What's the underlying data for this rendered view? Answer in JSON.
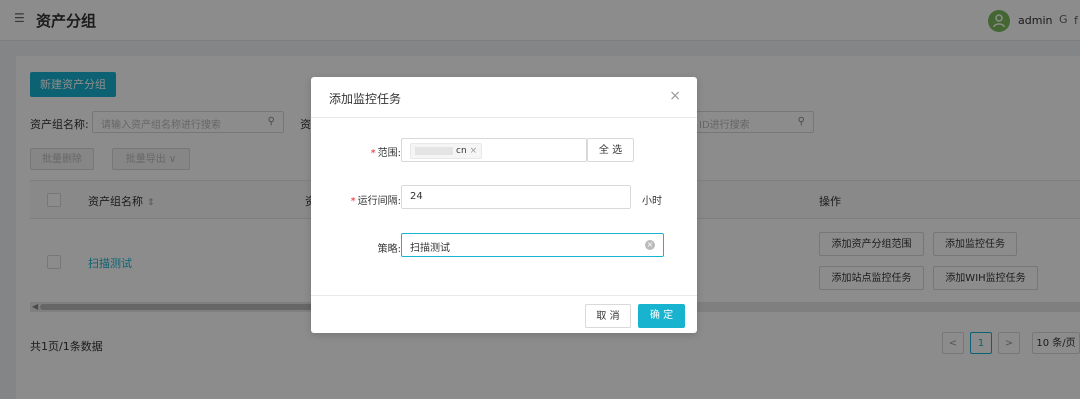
{
  "header": {
    "menu_icon": "menu-fold-icon",
    "title": "资产分组",
    "user": "admin",
    "logout_glyph": "G",
    "extra_glyph": "f"
  },
  "toolbar": {
    "new_group_label": "新建资产分组"
  },
  "filters": {
    "group_name_label": "资产组名称:",
    "group_name_placeholder": "请输入资产组名称进行搜索",
    "second_label_partial": "资",
    "third_placeholder_partial": "ID进行搜索"
  },
  "bulk": {
    "delete_label": "批量删除",
    "export_label": "批量导出",
    "export_caret": "∨"
  },
  "table": {
    "columns": [
      "资产组名称",
      "资",
      "操作"
    ],
    "sort_glyph": "⇕",
    "rows": [
      {
        "name": "扫描测试",
        "actions": [
          "添加资产分组范围",
          "添加监控任务",
          "添加站点监控任务",
          "添加WIH监控任务"
        ]
      }
    ]
  },
  "pagination": {
    "summary": "共1页/1条数据",
    "prev": "<",
    "current": "1",
    "next": ">",
    "page_size": "10 条/页"
  },
  "modal": {
    "title": "添加监控任务",
    "close_glyph": "×",
    "fields": {
      "scope_label": "范围:",
      "scope_tag_suffix": "cn",
      "scope_tag_close": "×",
      "select_all_label": "全 选",
      "interval_label": "运行间隔:",
      "interval_value": "24",
      "interval_unit": "小时",
      "policy_label": "策略:",
      "policy_value": "扫描测试"
    },
    "cancel_label": "取 消",
    "ok_label": "确 定"
  },
  "colors": {
    "accent": "#17b3cf",
    "required": "#f5222d",
    "avatar": "#7cbb5c"
  }
}
